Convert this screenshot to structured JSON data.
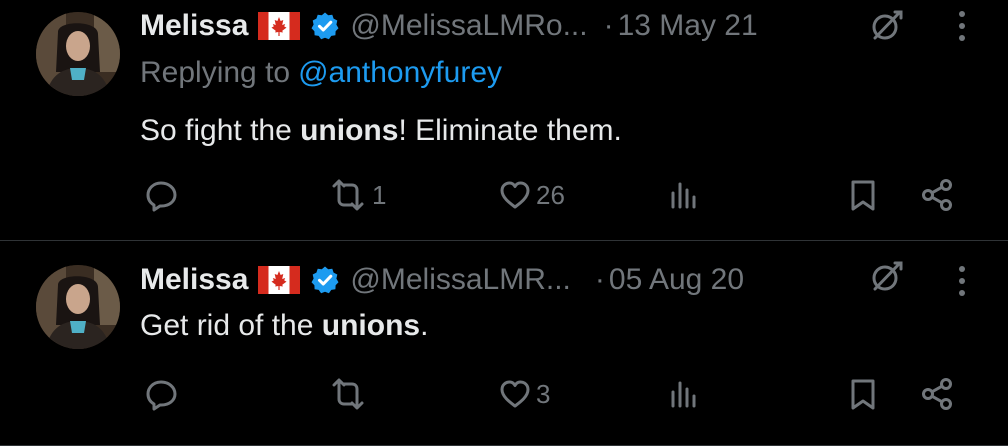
{
  "tweets": [
    {
      "author_name": "Melissa",
      "handle": "@MelissaLMRo...",
      "separator": "·",
      "date": "13 May 21",
      "replying_prefix": "Replying to",
      "replying_to": "@anthonyfurey",
      "text_before": "So fight the ",
      "text_bold": "unions",
      "text_after": "! Eliminate them.",
      "reply_count": "",
      "retweet_count": "1",
      "like_count": "26",
      "view_count": ""
    },
    {
      "author_name": "Melissa",
      "handle": "@MelissaLMR...",
      "separator": "·",
      "date": "05 Aug 20",
      "text_before": "Get rid of the ",
      "text_bold": "unions",
      "text_after": ".",
      "reply_count": "",
      "retweet_count": "",
      "like_count": "3",
      "view_count": ""
    }
  ],
  "colors": {
    "background": "#000000",
    "primary_text": "#e7e9ea",
    "secondary_text": "#71767b",
    "link": "#1d9bf0",
    "verified": "#1d9bf0",
    "flag_red": "#d52b1e"
  },
  "icons": [
    "canada-flag-icon",
    "verified-badge-icon",
    "grok-icon",
    "more-icon",
    "reply-icon",
    "retweet-icon",
    "like-icon",
    "views-icon",
    "bookmark-icon",
    "share-icon"
  ]
}
